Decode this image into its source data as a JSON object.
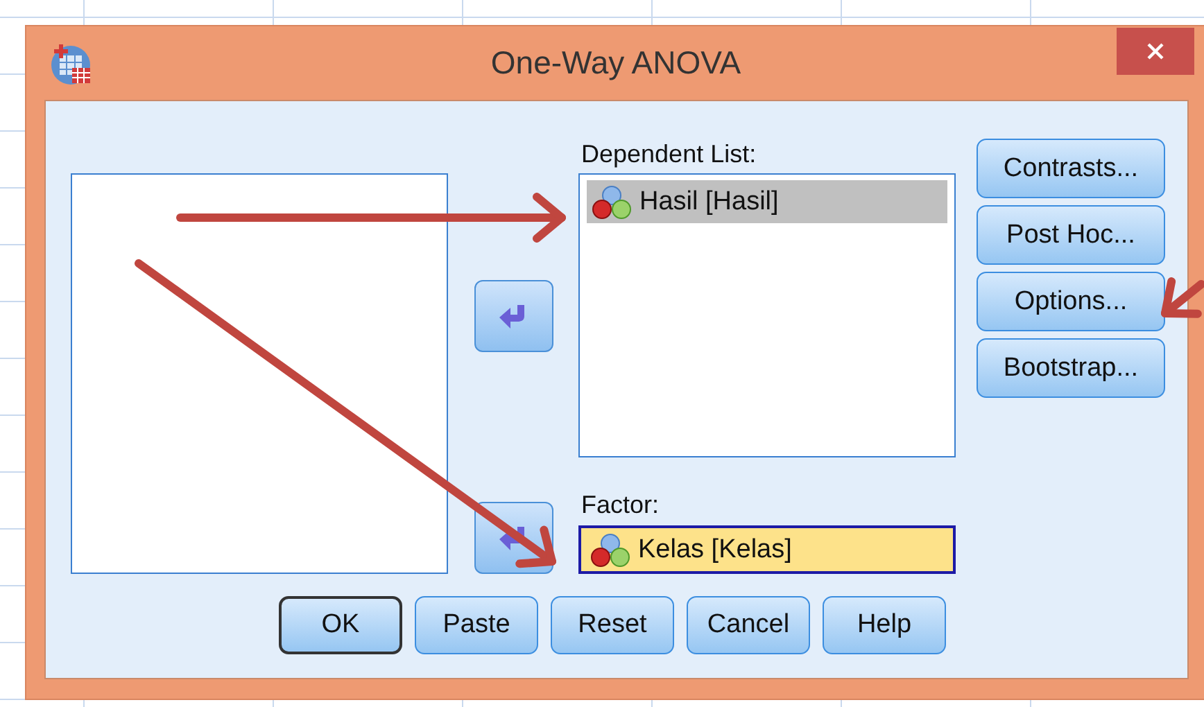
{
  "window": {
    "title": "One-Way ANOVA"
  },
  "dependent_list": {
    "label": "Dependent List:",
    "items": [
      {
        "text": "Hasil [Hasil]",
        "selected": true
      }
    ]
  },
  "factor": {
    "label": "Factor:",
    "value": "Kelas [Kelas]"
  },
  "side_buttons": [
    "Contrasts...",
    "Post Hoc...",
    "Options...",
    "Bootstrap..."
  ],
  "buttons": [
    {
      "label": "OK",
      "default": true
    },
    {
      "label": "Paste",
      "default": false
    },
    {
      "label": "Reset",
      "default": false
    },
    {
      "label": "Cancel",
      "default": false
    },
    {
      "label": "Help",
      "default": false
    }
  ]
}
